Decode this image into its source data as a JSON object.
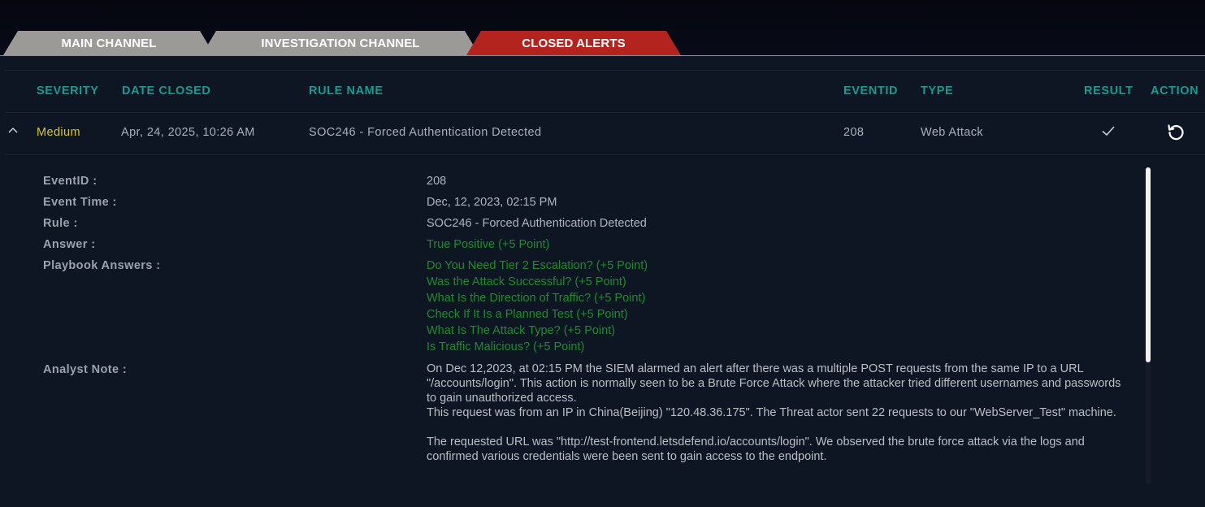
{
  "tabs": [
    {
      "label": "MAIN CHANNEL",
      "active": false
    },
    {
      "label": "INVESTIGATION CHANNEL",
      "active": false
    },
    {
      "label": "CLOSED ALERTS",
      "active": true
    }
  ],
  "columns": {
    "severity": "SEVERITY",
    "date_closed": "DATE CLOSED",
    "rule_name": "RULE NAME",
    "eventid": "EVENTID",
    "type": "TYPE",
    "result": "RESULT",
    "action": "ACTION"
  },
  "alert": {
    "severity": "Medium",
    "date_closed": "Apr, 24, 2025, 10:26 AM",
    "rule_name": "SOC246 - Forced Authentication Detected",
    "eventid": "208",
    "type": "Web Attack",
    "result_icon": "check-icon",
    "action_icon": "undo-icon"
  },
  "details": {
    "eventid_label": "EventID :",
    "eventid_value": "208",
    "event_time_label": "Event Time :",
    "event_time_value": "Dec, 12, 2023, 02:15 PM",
    "rule_label": "Rule :",
    "rule_value": "SOC246 - Forced Authentication Detected",
    "answer_label": "Answer :",
    "answer_value": "True Positive (+5 Point)",
    "playbook_label": "Playbook Answers :",
    "playbook_answers": [
      "Do You Need Tier 2 Escalation? (+5 Point)",
      "Was the Attack Successful? (+5 Point)",
      "What Is the Direction of Traffic? (+5 Point)",
      "Check If It Is a Planned Test (+5 Point)",
      "What Is The Attack Type? (+5 Point)",
      "Is Traffic Malicious? (+5 Point)"
    ],
    "note_label": "Analyst Note :",
    "note_lines": [
      "On Dec 12,2023, at 02:15 PM the SIEM alarmed an alert after there was a multiple POST requests from the same IP to a URL \"/accounts/login\". This action is normally seen to be a Brute Force Attack where the attacker tried different usernames and passwords to gain unauthorized access.",
      "This request was from an IP in China(Beijing) \"120.48.36.175\". The Threat actor sent 22 requests to our \"WebServer_Test\" machine.",
      "",
      "The requested URL was \"http://test-frontend.letsdefend.io/accounts/login\". We observed the brute force attack via the logs and confirmed various credentials were been sent to gain access to the endpoint."
    ]
  },
  "colors": {
    "accent_teal": "#1b9a8d",
    "active_tab": "#b3241f",
    "inactive_tab": "#9c9a97",
    "severity_medium": "#cfc83a",
    "positive_green": "#1f8a2e"
  }
}
